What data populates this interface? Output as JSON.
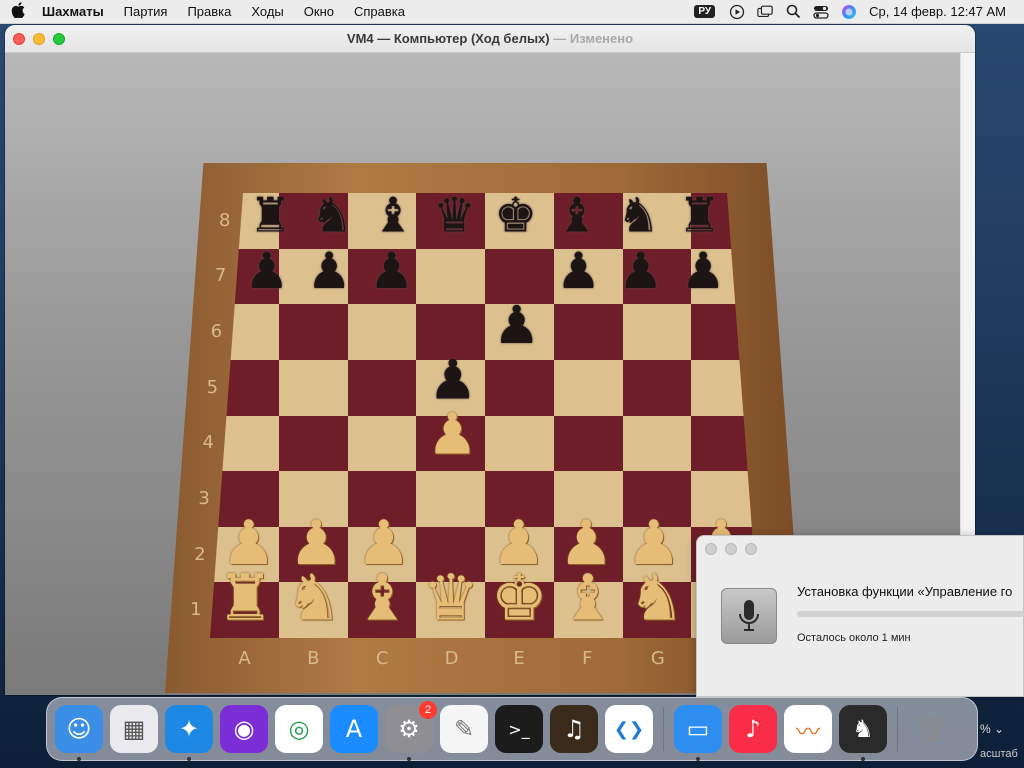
{
  "menubar": {
    "app": "Шахматы",
    "items": [
      "Партия",
      "Правка",
      "Ходы",
      "Окно",
      "Справка"
    ],
    "input_source": "РУ",
    "clock": "Ср, 14 февр.  12:47 AM"
  },
  "window": {
    "title_main": "VM4 — Компьютер   (Ход белых)",
    "title_sep": " — ",
    "title_status": "Изменено"
  },
  "board": {
    "files": [
      "A",
      "B",
      "C",
      "D",
      "E",
      "F",
      "G"
    ],
    "ranks": [
      "8",
      "7",
      "6",
      "5",
      "4",
      "3",
      "2",
      "1"
    ],
    "pieces": [
      {
        "sq": "a8",
        "color": "black",
        "type": "rook"
      },
      {
        "sq": "b8",
        "color": "black",
        "type": "knight"
      },
      {
        "sq": "c8",
        "color": "black",
        "type": "bishop"
      },
      {
        "sq": "d8",
        "color": "black",
        "type": "queen"
      },
      {
        "sq": "e8",
        "color": "black",
        "type": "king"
      },
      {
        "sq": "f8",
        "color": "black",
        "type": "bishop"
      },
      {
        "sq": "g8",
        "color": "black",
        "type": "knight"
      },
      {
        "sq": "h8",
        "color": "black",
        "type": "rook"
      },
      {
        "sq": "a7",
        "color": "black",
        "type": "pawn"
      },
      {
        "sq": "b7",
        "color": "black",
        "type": "pawn"
      },
      {
        "sq": "c7",
        "color": "black",
        "type": "pawn"
      },
      {
        "sq": "f7",
        "color": "black",
        "type": "pawn"
      },
      {
        "sq": "g7",
        "color": "black",
        "type": "pawn"
      },
      {
        "sq": "h7",
        "color": "black",
        "type": "pawn"
      },
      {
        "sq": "e6",
        "color": "black",
        "type": "pawn"
      },
      {
        "sq": "d5",
        "color": "black",
        "type": "pawn"
      },
      {
        "sq": "d4",
        "color": "white",
        "type": "pawn"
      },
      {
        "sq": "a2",
        "color": "white",
        "type": "pawn"
      },
      {
        "sq": "b2",
        "color": "white",
        "type": "pawn"
      },
      {
        "sq": "c2",
        "color": "white",
        "type": "pawn"
      },
      {
        "sq": "e2",
        "color": "white",
        "type": "pawn"
      },
      {
        "sq": "f2",
        "color": "white",
        "type": "pawn"
      },
      {
        "sq": "g2",
        "color": "white",
        "type": "pawn"
      },
      {
        "sq": "h2",
        "color": "white",
        "type": "pawn"
      },
      {
        "sq": "a1",
        "color": "white",
        "type": "rook"
      },
      {
        "sq": "b1",
        "color": "white",
        "type": "knight"
      },
      {
        "sq": "c1",
        "color": "white",
        "type": "bishop"
      },
      {
        "sq": "d1",
        "color": "white",
        "type": "queen"
      },
      {
        "sq": "e1",
        "color": "white",
        "type": "king"
      },
      {
        "sq": "f1",
        "color": "white",
        "type": "bishop"
      },
      {
        "sq": "g1",
        "color": "white",
        "type": "knight"
      }
    ]
  },
  "install_panel": {
    "title": "Установка функции «Управление го",
    "remaining": "Осталось около 1 мин",
    "progress": 0
  },
  "dock": {
    "apps": [
      {
        "name": "finder",
        "icon": "finder-icon",
        "bg": "#3a8ee6",
        "running": true
      },
      {
        "name": "launchpad",
        "icon": "launchpad-icon",
        "bg": "#e9e9ee",
        "running": false
      },
      {
        "name": "safari",
        "icon": "safari-icon",
        "bg": "#1e88e5",
        "running": true
      },
      {
        "name": "firefox",
        "icon": "firefox-icon",
        "bg": "#7b2ed6",
        "running": false
      },
      {
        "name": "chrome",
        "icon": "chrome-icon",
        "bg": "#ffffff",
        "running": false
      },
      {
        "name": "app-store",
        "icon": "app-store-icon",
        "bg": "#1a8cff",
        "running": false
      },
      {
        "name": "system-settings",
        "icon": "gear-icon",
        "bg": "#8e8e93",
        "running": true,
        "badge": "2"
      },
      {
        "name": "textedit",
        "icon": "textedit-icon",
        "bg": "#f5f5f5",
        "running": false
      },
      {
        "name": "terminal",
        "icon": "terminal-icon",
        "bg": "#1c1c1c",
        "running": false
      },
      {
        "name": "garageband",
        "icon": "guitar-icon",
        "bg": "#3a2a1a",
        "running": false
      },
      {
        "name": "vscode",
        "icon": "vscode-icon",
        "bg": "#ffffff",
        "running": false
      }
    ],
    "apps_right": [
      {
        "name": "keynote",
        "icon": "keynote-icon",
        "bg": "#2e8ef0",
        "running": true
      },
      {
        "name": "music",
        "icon": "music-icon",
        "bg": "#fa2d48",
        "running": false
      },
      {
        "name": "freeform",
        "icon": "freeform-icon",
        "bg": "#ffffff",
        "running": false
      },
      {
        "name": "chess",
        "icon": "chess-icon",
        "bg": "#2a2a2a",
        "running": true
      }
    ],
    "trash": {
      "name": "trash",
      "icon": "trash-icon"
    }
  },
  "background_fragments": {
    "zoom": "% ⌄",
    "label": "асштаб"
  }
}
